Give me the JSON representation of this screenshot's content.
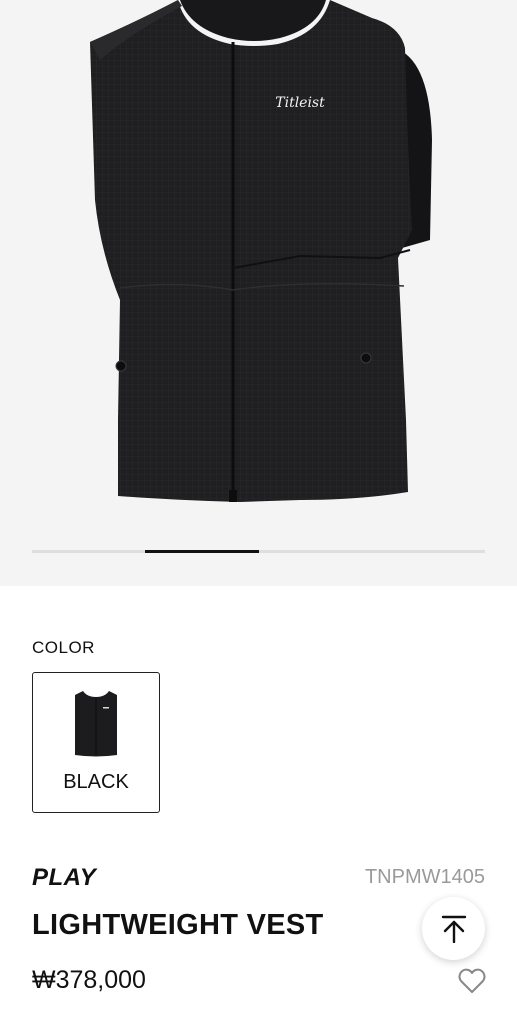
{
  "gallery": {
    "image_alt_logo": "Titleist",
    "progress": 0.25,
    "slide_index": 2,
    "slide_count": 4
  },
  "color_section": {
    "label": "COLOR",
    "swatches": [
      {
        "name": "BLACK",
        "selected": true
      }
    ]
  },
  "product": {
    "brand": "PLAY",
    "sku": "TNPMW1405",
    "title": "LIGHTWEIGHT VEST",
    "price": "₩378,000"
  },
  "icons": {
    "scroll_top": "arrow-up-to-line-icon",
    "wishlist": "heart-icon"
  },
  "colors": {
    "gallery_bg": "#f4f4f4",
    "garment": "#1f1f21",
    "text": "#111111",
    "muted": "#9a9a9a"
  }
}
